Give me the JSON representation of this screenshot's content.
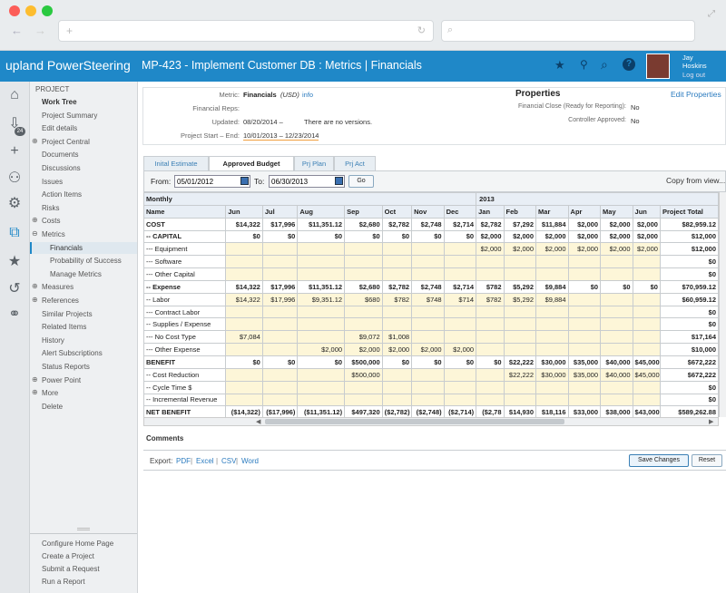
{
  "app": {
    "brand": "upland PowerSteering",
    "title": "MP-423 - Implement Customer DB : Metrics | Financials",
    "user_first": "Jay",
    "user_last": "Hoskins",
    "logout": "Log out"
  },
  "rail_icons": [
    "home-icon",
    "inbox-icon",
    "plus-icon",
    "binoculars-icon",
    "gear-icon",
    "chart-icon",
    "star-icon",
    "history-icon",
    "link-icon"
  ],
  "rail_badge": "24",
  "sidebar": {
    "section": "PROJECT",
    "items": [
      {
        "label": "Work Tree",
        "bold": true
      },
      {
        "label": "Project Summary"
      },
      {
        "label": "Edit details"
      },
      {
        "label": "Project Central",
        "plus": true
      },
      {
        "label": "Documents"
      },
      {
        "label": "Discussions"
      },
      {
        "label": "Issues"
      },
      {
        "label": "Action Items"
      },
      {
        "label": "Risks"
      },
      {
        "label": "Costs",
        "plus": true
      },
      {
        "label": "Metrics",
        "minus": true
      },
      {
        "label": "Financials",
        "sub": true,
        "active": true
      },
      {
        "label": "Probability of Success",
        "sub": true
      },
      {
        "label": "Manage Metrics",
        "sub": true
      },
      {
        "label": "Measures",
        "plus": true
      },
      {
        "label": "References",
        "plus": true
      },
      {
        "label": "Similar Projects"
      },
      {
        "label": "Related Items"
      },
      {
        "label": "History"
      },
      {
        "label": "Alert Subscriptions"
      },
      {
        "label": "Status Reports"
      },
      {
        "label": "Power Point",
        "plus": true
      },
      {
        "label": "More",
        "plus": true
      },
      {
        "label": "Delete"
      }
    ],
    "bottom": [
      "Configure Home Page",
      "Create a Project",
      "Submit a Request",
      "Run a Report"
    ]
  },
  "info": {
    "metric_label": "Metric:",
    "metric_value": "Financials",
    "currency": "(USD)",
    "info_link": "info",
    "reps_label": "Financial Reps:",
    "updated_label": "Updated:",
    "updated_value": "08/20/2014 –",
    "versions": "There are no versions.",
    "dates_label": "Project Start – End:",
    "dates_value": "10/01/2013 – 12/23/2014"
  },
  "props": {
    "title": "Properties",
    "edit": "Edit Properties",
    "close_label": "Financial Close (Ready for Reporting):",
    "close_value": "No",
    "approved_label": "Controller Approved:",
    "approved_value": "No"
  },
  "tabs": [
    "Inital Estimate",
    "Approved Budget",
    "Prj Plan",
    "Prj Act"
  ],
  "filter": {
    "from_label": "From:",
    "from": "05/01/2012",
    "to_label": "To:",
    "to": "06/30/2013",
    "go": "Go",
    "copy": "Copy from view..."
  },
  "grid": {
    "monthly": "Monthly",
    "year2013": "2013",
    "headers": [
      "Name",
      "Jun",
      "Jul",
      "Aug",
      "Sep",
      "Oct",
      "Nov",
      "Dec",
      "Jan",
      "Feb",
      "Mar",
      "Apr",
      "May",
      "Jun",
      "Project Total"
    ],
    "rows": [
      {
        "kind": "bold",
        "c": [
          "COST",
          "$14,322",
          "$17,996",
          "$11,351.12",
          "$2,680",
          "$2,782",
          "$2,748",
          "$2,714",
          "$2,782",
          "$7,292",
          "$11,884",
          "$2,000",
          "$2,000",
          "$2,000",
          "$82,959.12"
        ]
      },
      {
        "kind": "bold",
        "c": [
          "-- CAPITAL",
          "$0",
          "$0",
          "$0",
          "$0",
          "$0",
          "$0",
          "$0",
          "$2,000",
          "$2,000",
          "$2,000",
          "$2,000",
          "$2,000",
          "$2,000",
          "$12,000"
        ]
      },
      {
        "kind": "edit",
        "c": [
          "--- Equipment",
          "",
          "",
          "",
          "",
          "",
          "",
          "",
          "$2,000",
          "$2,000",
          "$2,000",
          "$2,000",
          "$2,000",
          "$2,000",
          "$12,000"
        ]
      },
      {
        "kind": "edit",
        "c": [
          "--- Software",
          "",
          "",
          "",
          "",
          "",
          "",
          "",
          "",
          "",
          "",
          "",
          "",
          "",
          "$0"
        ]
      },
      {
        "kind": "edit",
        "c": [
          "--- Other Capital",
          "",
          "",
          "",
          "",
          "",
          "",
          "",
          "",
          "",
          "",
          "",
          "",
          "",
          "$0"
        ]
      },
      {
        "kind": "bold",
        "c": [
          "-- Expense",
          "$14,322",
          "$17,996",
          "$11,351.12",
          "$2,680",
          "$2,782",
          "$2,748",
          "$2,714",
          "$782",
          "$5,292",
          "$9,884",
          "$0",
          "$0",
          "$0",
          "$70,959.12"
        ]
      },
      {
        "kind": "edit",
        "c": [
          "-- Labor",
          "$14,322",
          "$17,996",
          "$9,351.12",
          "$680",
          "$782",
          "$748",
          "$714",
          "$782",
          "$5,292",
          "$9,884",
          "",
          "",
          "",
          "$60,959.12"
        ]
      },
      {
        "kind": "edit",
        "c": [
          "--- Contract Labor",
          "",
          "",
          "",
          "",
          "",
          "",
          "",
          "",
          "",
          "",
          "",
          "",
          "",
          "$0"
        ]
      },
      {
        "kind": "edit",
        "c": [
          "-- Supplies / Expense",
          "",
          "",
          "",
          "",
          "",
          "",
          "",
          "",
          "",
          "",
          "",
          "",
          "",
          "$0"
        ]
      },
      {
        "kind": "edit",
        "c": [
          "--- No Cost Type",
          "$7,084",
          "",
          "",
          "$9,072",
          "$1,008",
          "",
          "",
          "",
          "",
          "",
          "",
          "",
          "",
          "$17,164"
        ]
      },
      {
        "kind": "edit",
        "c": [
          "--- Other Expense",
          "",
          "",
          "$2,000",
          "$2,000",
          "$2,000",
          "$2,000",
          "$2,000",
          "",
          "",
          "",
          "",
          "",
          "",
          "$10,000"
        ]
      },
      {
        "kind": "bold",
        "c": [
          "BENEFIT",
          "$0",
          "$0",
          "$0",
          "$500,000",
          "$0",
          "$0",
          "$0",
          "$0",
          "$22,222",
          "$30,000",
          "$35,000",
          "$40,000",
          "$45,000",
          "$672,222"
        ]
      },
      {
        "kind": "edit",
        "c": [
          "-- Cost Reduction",
          "",
          "",
          "",
          "$500,000",
          "",
          "",
          "",
          "",
          "$22,222",
          "$30,000",
          "$35,000",
          "$40,000",
          "$45,000",
          "$672,222"
        ]
      },
      {
        "kind": "edit",
        "c": [
          "-- Cycle Time $",
          "",
          "",
          "",
          "",
          "",
          "",
          "",
          "",
          "",
          "",
          "",
          "",
          "",
          "$0"
        ]
      },
      {
        "kind": "edit",
        "c": [
          "-- Incremental Revenue",
          "",
          "",
          "",
          "",
          "",
          "",
          "",
          "",
          "",
          "",
          "",
          "",
          "",
          "$0"
        ]
      },
      {
        "kind": "bold",
        "c": [
          "NET BENEFIT",
          "($14,322)",
          "($17,996)",
          "($11,351.12)",
          "$497,320",
          "($2,782)",
          "($2,748)",
          "($2,714)",
          "($2,78",
          "$14,930",
          "$18,116",
          "$33,000",
          "$38,000",
          "$43,000",
          "$589,262.88"
        ]
      }
    ]
  },
  "comments": "Comments",
  "export": {
    "label": "Export:",
    "links": [
      "PDF",
      "Excel",
      "CSV",
      "Word"
    ]
  },
  "buttons": {
    "save": "Save Changes",
    "reset": "Reset"
  },
  "colors": {
    "brand": "#1f88c8",
    "editable": "#fdf6d8",
    "header": "#e8eef5"
  }
}
